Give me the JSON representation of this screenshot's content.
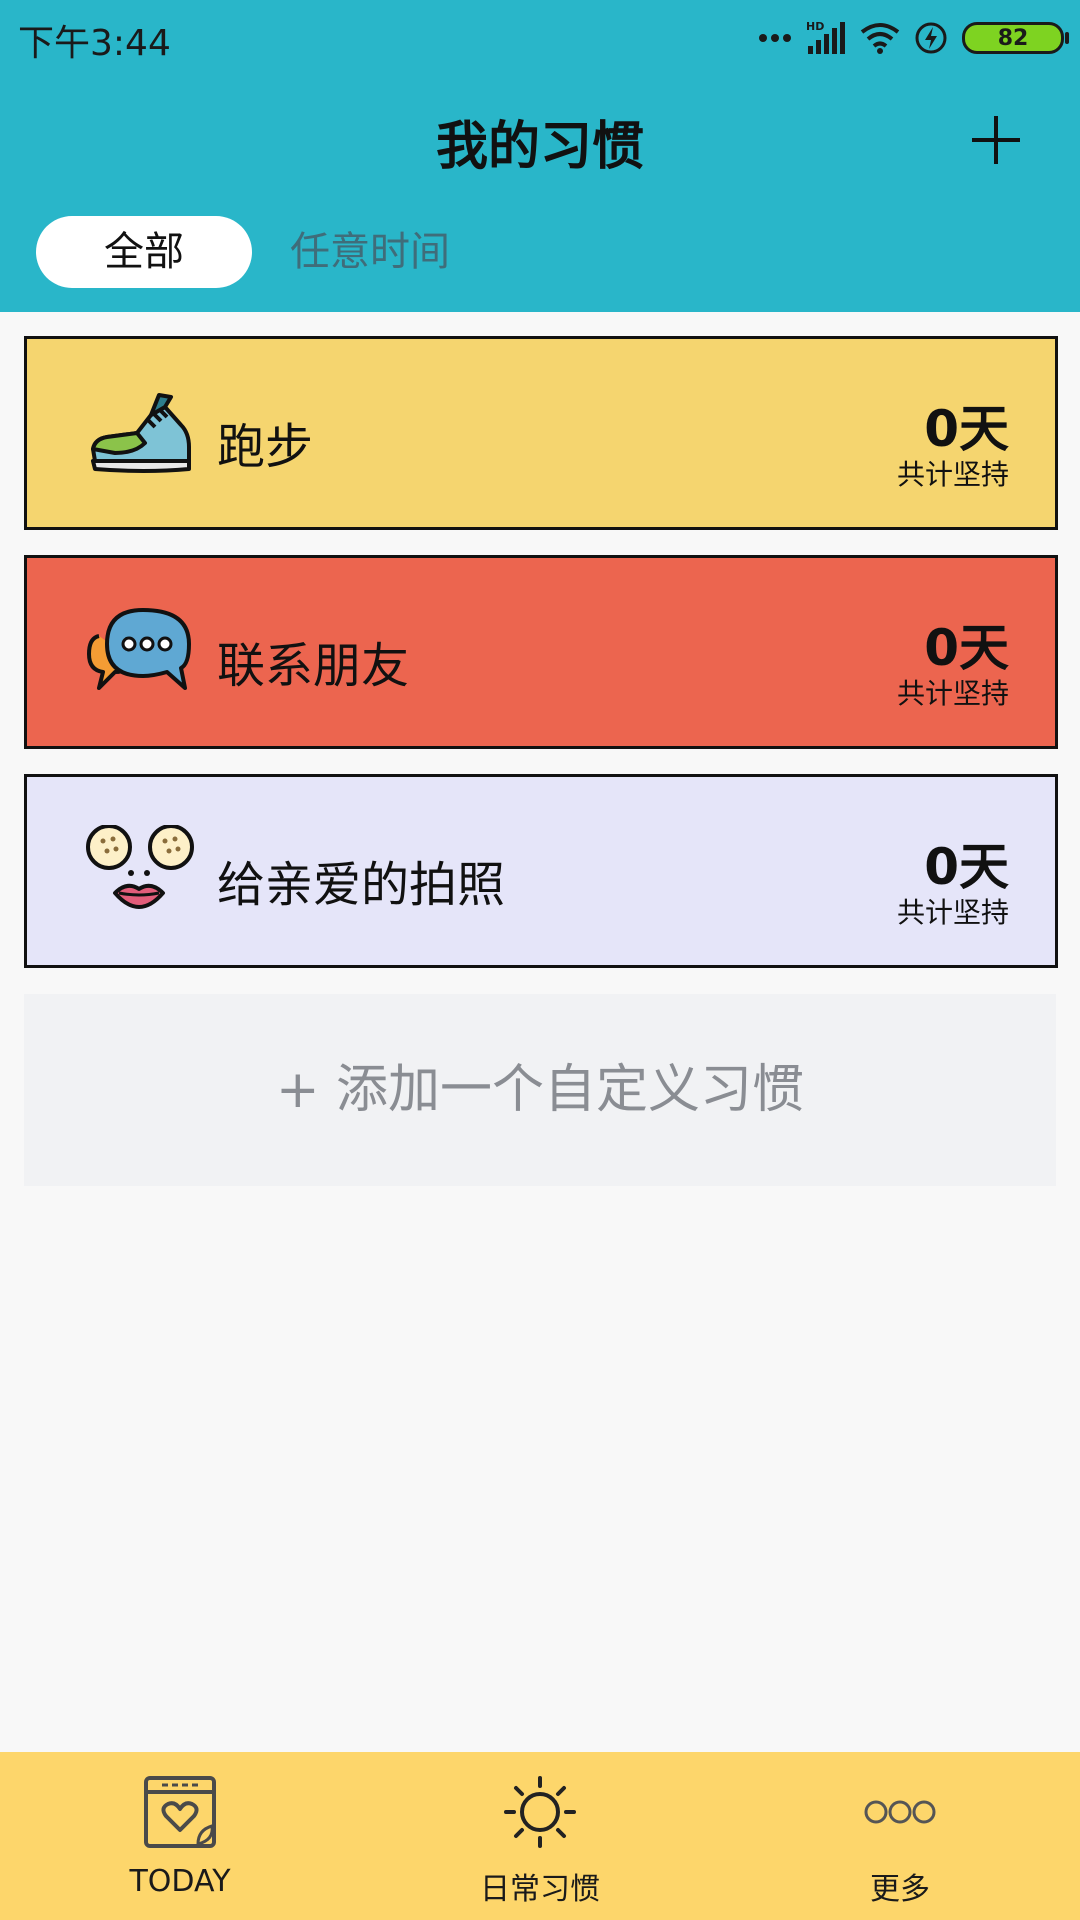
{
  "status_bar": {
    "time": "下午3:44",
    "battery": "82",
    "network": "HD"
  },
  "header": {
    "title": "我的习惯",
    "add_icon": "plus-icon",
    "bg_color": "#29b6c9"
  },
  "tabs": [
    {
      "label": "全部",
      "active": true
    },
    {
      "label": "任意时间",
      "active": false
    }
  ],
  "habits": [
    {
      "name": "跑步",
      "days": "0天",
      "sub": "共计坚持",
      "icon": "running-shoe-icon",
      "color": "#f5d56f"
    },
    {
      "name": "联系朋友",
      "days": "0天",
      "sub": "共计坚持",
      "icon": "chat-bubbles-icon",
      "color": "#ec654f"
    },
    {
      "name": "给亲爱的拍照",
      "days": "0天",
      "sub": "共计坚持",
      "icon": "face-icon",
      "color": "#e5e5f9"
    }
  ],
  "add_custom": "+ 添加一个自定义习惯",
  "bottom_nav": [
    {
      "label": "TODAY",
      "icon": "calendar-heart-icon"
    },
    {
      "label": "日常习惯",
      "icon": "sun-icon"
    },
    {
      "label": "更多",
      "icon": "more-dots-icon"
    }
  ],
  "bottom_nav_color": "#fdd66b"
}
